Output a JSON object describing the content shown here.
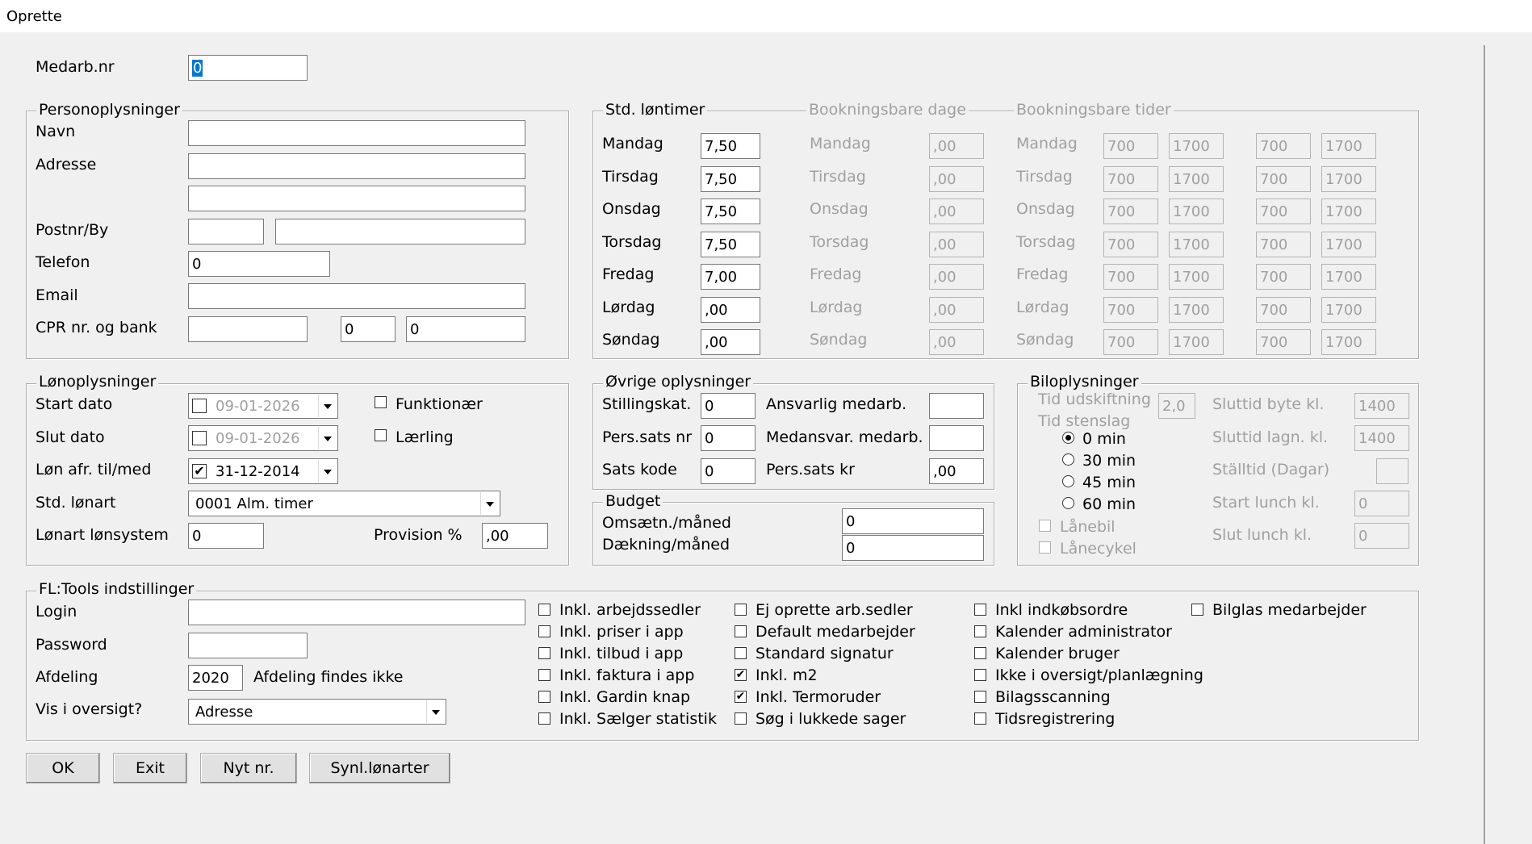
{
  "window": {
    "title": "Oprette"
  },
  "medarb": {
    "label": "Medarb.nr",
    "value": "0"
  },
  "person": {
    "title": "Personoplysninger",
    "navn_label": "Navn",
    "adresse_label": "Adresse",
    "postnr_label": "Postnr/By",
    "telefon_label": "Telefon",
    "telefon_value": "0",
    "email_label": "Email",
    "cpr_label": "CPR nr. og bank",
    "bank_reg": "0",
    "bank_konto": "0"
  },
  "std": {
    "title": "Std. løntimer",
    "booking_days_title": "Bookningsbare dage",
    "booking_times_title": "Bookningsbare tider",
    "days": [
      {
        "name": "Mandag",
        "hours": "7,50",
        "booking": ",00",
        "t1": "700",
        "t2": "1700",
        "t3": "700",
        "t4": "1700"
      },
      {
        "name": "Tirsdag",
        "hours": "7,50",
        "booking": ",00",
        "t1": "700",
        "t2": "1700",
        "t3": "700",
        "t4": "1700"
      },
      {
        "name": "Onsdag",
        "hours": "7,50",
        "booking": ",00",
        "t1": "700",
        "t2": "1700",
        "t3": "700",
        "t4": "1700"
      },
      {
        "name": "Torsdag",
        "hours": "7,50",
        "booking": ",00",
        "t1": "700",
        "t2": "1700",
        "t3": "700",
        "t4": "1700"
      },
      {
        "name": "Fredag",
        "hours": "7,00",
        "booking": ",00",
        "t1": "700",
        "t2": "1700",
        "t3": "700",
        "t4": "1700"
      },
      {
        "name": "Lørdag",
        "hours": ",00",
        "booking": ",00",
        "t1": "700",
        "t2": "1700",
        "t3": "700",
        "t4": "1700"
      },
      {
        "name": "Søndag",
        "hours": ",00",
        "booking": ",00",
        "t1": "700",
        "t2": "1700",
        "t3": "700",
        "t4": "1700"
      }
    ]
  },
  "lon": {
    "title": "Lønoplysninger",
    "start_label": "Start dato",
    "start_value": "09-01-2026",
    "slut_label": "Slut dato",
    "slut_value": "09-01-2026",
    "afr_label": "Løn afr. til/med",
    "afr_value": "31-12-2014",
    "funktionaer": "Funktionær",
    "laerling": "Lærling",
    "lonart_label": "Std. lønart",
    "lonart_value": "0001 Alm. timer",
    "lonsystem_label": "Lønart lønsystem",
    "lonsystem_value": "0",
    "provision_label": "Provision %",
    "provision_value": ",00"
  },
  "ovrige": {
    "title": "Øvrige oplysninger",
    "stillingskat_label": "Stillingskat.",
    "stillingskat_value": "0",
    "perssats_nr_label": "Pers.sats nr",
    "perssats_nr_value": "0",
    "sats_kode_label": "Sats kode",
    "sats_kode_value": "0",
    "ansvarlig_label": "Ansvarlig medarb.",
    "medansvar_label": "Medansvar. medarb.",
    "perssats_kr_label": "Pers.sats kr",
    "perssats_kr_value": ",00"
  },
  "budget": {
    "title": "Budget",
    "omsaetn_label": "Omsætn./måned",
    "omsaetn_value": "0",
    "daekning_label": "Dækning/måned",
    "daekning_value": "0"
  },
  "bil": {
    "title": "Biloplysninger",
    "tid_udskiftning_label": "Tid udskiftning",
    "tid_udskiftning_value": "2,0",
    "tid_stenslag_label": "Tid stenslag",
    "radios": [
      "0 min",
      "30 min",
      "45 min",
      "60 min"
    ],
    "selected_radio": "0 min",
    "lanebil": "Lånebil",
    "lanecykel": "Lånecykel",
    "sluttid_byte_label": "Sluttid byte kl.",
    "sluttid_byte_value": "1400",
    "sluttid_lagn_label": "Sluttid lagn. kl.",
    "sluttid_lagn_value": "1400",
    "stalltid_label": "Ställtid (Dagar)",
    "start_lunch_label": "Start lunch kl.",
    "start_lunch_value": "0",
    "slut_lunch_label": "Slut lunch kl.",
    "slut_lunch_value": "0"
  },
  "fl": {
    "title": "FL:Tools indstillinger",
    "login_label": "Login",
    "password_label": "Password",
    "afdeling_label": "Afdeling",
    "afdeling_value": "2020",
    "afdeling_status": "Afdeling findes ikke",
    "vis_label": "Vis i oversigt?",
    "vis_value": "Adresse",
    "col1": [
      {
        "label": "Inkl. arbejdssedler",
        "checked": false
      },
      {
        "label": "Inkl. priser i app",
        "checked": false
      },
      {
        "label": "Inkl. tilbud i app",
        "checked": false
      },
      {
        "label": "Inkl. faktura i app",
        "checked": false
      },
      {
        "label": "Inkl. Gardin knap",
        "checked": false
      },
      {
        "label": "Inkl. Sælger statistik",
        "checked": false
      }
    ],
    "col2": [
      {
        "label": "Ej oprette arb.sedler",
        "checked": false
      },
      {
        "label": "Default medarbejder",
        "checked": false
      },
      {
        "label": "Standard signatur",
        "checked": false
      },
      {
        "label": "Inkl. m2",
        "checked": true
      },
      {
        "label": "Inkl. Termoruder",
        "checked": true
      },
      {
        "label": "Søg i lukkede sager",
        "checked": false
      }
    ],
    "col3": [
      {
        "label": "Inkl indkøbsordre",
        "checked": false
      },
      {
        "label": "Kalender administrator",
        "checked": false
      },
      {
        "label": "Kalender bruger",
        "checked": false
      },
      {
        "label": "Ikke i oversigt/planlægning",
        "checked": false
      },
      {
        "label": "Bilagsscanning",
        "checked": false
      },
      {
        "label": "Tidsregistrering",
        "checked": false
      }
    ],
    "col4": [
      {
        "label": "Bilglas medarbejder",
        "checked": false
      }
    ]
  },
  "buttons": {
    "ok": "OK",
    "exit": "Exit",
    "nyt": "Nyt nr.",
    "synl": "Synl.lønarter"
  }
}
